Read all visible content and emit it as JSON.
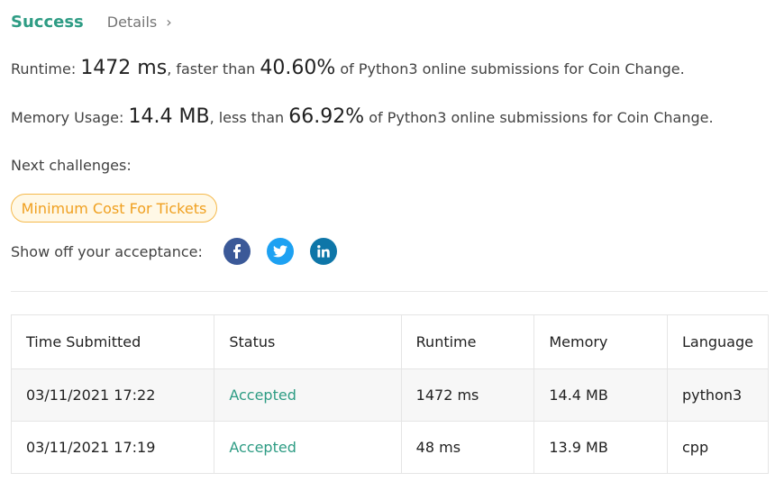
{
  "header": {
    "status": "Success",
    "details": "Details",
    "details_chevron": "›"
  },
  "runtime": {
    "label": "Runtime:",
    "value": "1472 ms",
    "middle": ", faster than",
    "percent": "40.60%",
    "suffix": "of Python3 online submissions for Coin Change."
  },
  "memory": {
    "label": "Memory Usage:",
    "value": "14.4 MB",
    "middle": ", less than",
    "percent": "66.92%",
    "suffix": "of Python3 online submissions for Coin Change."
  },
  "next_challenges": {
    "label": "Next challenges:",
    "items": [
      "Minimum Cost For Tickets"
    ]
  },
  "share": {
    "label": "Show off your acceptance:",
    "icons": [
      "facebook-icon",
      "twitter-icon",
      "linkedin-icon"
    ],
    "colors": {
      "facebook": "#3b5998",
      "twitter": "#1da1f2",
      "linkedin": "#0e76a8"
    }
  },
  "submissions": {
    "headers": [
      "Time Submitted",
      "Status",
      "Runtime",
      "Memory",
      "Language"
    ],
    "rows": [
      [
        "03/11/2021 17:22",
        "Accepted",
        "1472 ms",
        "14.4 MB",
        "python3"
      ],
      [
        "03/11/2021 17:19",
        "Accepted",
        "48 ms",
        "13.9 MB",
        "cpp"
      ]
    ]
  },
  "colors": {
    "success": "#2e9c84",
    "tag_border": "#f5b94b",
    "tag_text": "#f0a020"
  }
}
